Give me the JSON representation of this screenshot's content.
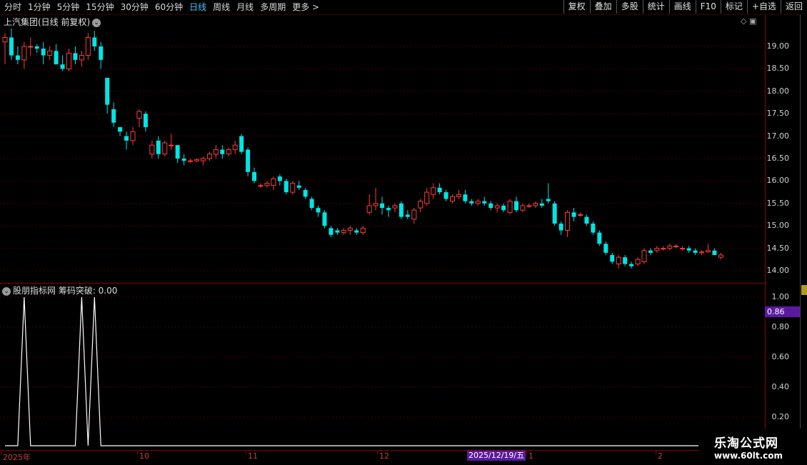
{
  "toolbar": {
    "periods": [
      "分时",
      "1分钟",
      "5分钟",
      "15分钟",
      "30分钟",
      "60分钟",
      "日线",
      "周线",
      "月线",
      "多周期",
      "更多 >"
    ],
    "active": "日线",
    "right_buttons": [
      "复权",
      "叠加",
      "多股",
      "统计",
      "画线",
      "F10",
      "标记",
      "+自选",
      "返回"
    ]
  },
  "chart": {
    "title": "上汽集团(日线 前复权)",
    "price_ticks": [
      "19.00",
      "18.50",
      "18.00",
      "17.50",
      "17.00",
      "16.50",
      "16.00",
      "15.50",
      "15.00",
      "14.50",
      "14.00"
    ],
    "indicator_title": "股朋指标网 筹码突破: 0.00",
    "indicator_ticks": [
      "1.00",
      "0.80",
      "0.60",
      "0.40",
      "0.20"
    ],
    "indicator_current": "0.86",
    "date_labels": [
      "2025年",
      "10",
      "11",
      "12",
      "1",
      "2"
    ],
    "date_highlight": "2025/12/19/五",
    "colors": {
      "up": "#ff3b3b",
      "down": "#00e5e5",
      "indicator": "#ffffff",
      "axis": "#8a0000"
    }
  },
  "watermark": {
    "title": "乐淘公式网",
    "url": "www.60lt.com"
  },
  "chart_data": {
    "type": "candlestick",
    "title": "上汽集团(日线 前复权)",
    "candles": [
      [
        19.1,
        19.3,
        18.6,
        19.2
      ],
      [
        19.2,
        19.4,
        18.7,
        18.8
      ],
      [
        18.8,
        19.0,
        18.6,
        18.7
      ],
      [
        18.7,
        19.1,
        18.5,
        19.0
      ],
      [
        19.0,
        19.2,
        18.8,
        19.0
      ],
      [
        19.0,
        19.05,
        18.85,
        18.95
      ],
      [
        18.95,
        19.1,
        18.6,
        18.8
      ],
      [
        18.8,
        19.0,
        18.7,
        18.9
      ],
      [
        18.9,
        19.05,
        18.6,
        18.6
      ],
      [
        18.6,
        18.8,
        18.45,
        18.5
      ],
      [
        18.5,
        18.95,
        18.45,
        18.85
      ],
      [
        18.85,
        19.0,
        18.6,
        18.7
      ],
      [
        18.7,
        18.9,
        18.55,
        18.8
      ],
      [
        18.8,
        19.3,
        18.7,
        19.2
      ],
      [
        19.2,
        19.35,
        18.9,
        19.0
      ],
      [
        19.0,
        19.1,
        18.5,
        18.7
      ],
      [
        18.3,
        18.3,
        17.5,
        17.7
      ],
      [
        17.6,
        17.75,
        17.2,
        17.3
      ],
      [
        17.2,
        17.2,
        17.0,
        17.1
      ],
      [
        17.0,
        17.1,
        16.7,
        16.9
      ],
      [
        16.9,
        17.2,
        16.8,
        17.1
      ],
      [
        17.4,
        17.6,
        17.2,
        17.55
      ],
      [
        17.5,
        17.55,
        17.1,
        17.2
      ],
      [
        16.6,
        16.9,
        16.5,
        16.8
      ],
      [
        16.9,
        17.0,
        16.5,
        16.6
      ],
      [
        16.6,
        16.9,
        16.55,
        16.85
      ],
      [
        16.8,
        17.05,
        16.7,
        16.8
      ],
      [
        16.8,
        16.8,
        16.4,
        16.5
      ],
      [
        16.5,
        16.6,
        16.35,
        16.45
      ],
      [
        16.45,
        16.5,
        16.4,
        16.45
      ],
      [
        16.45,
        16.5,
        16.42,
        16.48
      ],
      [
        16.45,
        16.55,
        16.35,
        16.5
      ],
      [
        16.5,
        16.65,
        16.45,
        16.6
      ],
      [
        16.6,
        16.8,
        16.5,
        16.7
      ],
      [
        16.7,
        16.8,
        16.5,
        16.6
      ],
      [
        16.6,
        16.75,
        16.55,
        16.7
      ],
      [
        16.7,
        16.9,
        16.6,
        16.8
      ],
      [
        17.0,
        17.05,
        16.6,
        16.65
      ],
      [
        16.7,
        16.75,
        16.1,
        16.2
      ],
      [
        16.2,
        16.3,
        15.95,
        16.0
      ],
      [
        15.9,
        15.95,
        15.85,
        15.9
      ],
      [
        15.9,
        16.0,
        15.85,
        15.95
      ],
      [
        15.9,
        16.1,
        15.8,
        16.05
      ],
      [
        16.1,
        16.15,
        15.9,
        16.0
      ],
      [
        16.0,
        16.05,
        15.7,
        15.75
      ],
      [
        15.75,
        16.0,
        15.7,
        15.95
      ],
      [
        15.9,
        16.0,
        15.8,
        15.85
      ],
      [
        15.8,
        15.85,
        15.6,
        15.65
      ],
      [
        15.6,
        15.65,
        15.35,
        15.4
      ],
      [
        15.4,
        15.45,
        15.2,
        15.3
      ],
      [
        15.3,
        15.35,
        14.95,
        15.0
      ],
      [
        14.95,
        15.0,
        14.75,
        14.8
      ],
      [
        14.9,
        14.95,
        14.8,
        14.85
      ],
      [
        14.85,
        14.95,
        14.8,
        14.9
      ],
      [
        14.9,
        15.0,
        14.8,
        14.95
      ],
      [
        14.9,
        14.95,
        14.8,
        14.85
      ],
      [
        14.85,
        15.0,
        14.8,
        14.95
      ],
      [
        15.3,
        15.7,
        15.25,
        15.45
      ],
      [
        15.45,
        15.85,
        15.35,
        15.5
      ],
      [
        15.5,
        15.65,
        15.25,
        15.4
      ],
      [
        15.4,
        15.45,
        15.2,
        15.35
      ],
      [
        15.4,
        15.5,
        15.3,
        15.45
      ],
      [
        15.5,
        15.55,
        15.15,
        15.2
      ],
      [
        15.25,
        15.35,
        15.15,
        15.2
      ],
      [
        15.15,
        15.4,
        15.05,
        15.35
      ],
      [
        15.4,
        15.6,
        15.3,
        15.55
      ],
      [
        15.5,
        15.85,
        15.45,
        15.75
      ],
      [
        15.7,
        15.95,
        15.6,
        15.85
      ],
      [
        15.85,
        15.95,
        15.7,
        15.75
      ],
      [
        15.75,
        15.8,
        15.55,
        15.6
      ],
      [
        15.55,
        15.7,
        15.5,
        15.65
      ],
      [
        15.65,
        15.8,
        15.6,
        15.7
      ],
      [
        15.7,
        15.8,
        15.5,
        15.55
      ],
      [
        15.55,
        15.6,
        15.45,
        15.5
      ],
      [
        15.5,
        15.6,
        15.45,
        15.55
      ],
      [
        15.55,
        15.65,
        15.45,
        15.5
      ],
      [
        15.5,
        15.55,
        15.35,
        15.4
      ],
      [
        15.4,
        15.5,
        15.3,
        15.45
      ],
      [
        15.45,
        15.5,
        15.3,
        15.35
      ],
      [
        15.3,
        15.6,
        15.25,
        15.55
      ],
      [
        15.55,
        15.65,
        15.3,
        15.35
      ],
      [
        15.35,
        15.5,
        15.3,
        15.45
      ],
      [
        15.45,
        15.5,
        15.4,
        15.45
      ],
      [
        15.45,
        15.55,
        15.4,
        15.5
      ],
      [
        15.5,
        15.6,
        15.4,
        15.45
      ],
      [
        15.6,
        15.95,
        15.5,
        15.55
      ],
      [
        15.5,
        15.55,
        15.0,
        15.05
      ],
      [
        15.05,
        15.1,
        14.8,
        14.9
      ],
      [
        14.9,
        15.35,
        14.75,
        15.3
      ],
      [
        15.3,
        15.4,
        15.1,
        15.2
      ],
      [
        15.25,
        15.3,
        15.2,
        15.25
      ],
      [
        15.2,
        15.25,
        15.0,
        15.05
      ],
      [
        15.05,
        15.1,
        14.8,
        14.85
      ],
      [
        14.85,
        14.9,
        14.55,
        14.6
      ],
      [
        14.6,
        14.65,
        14.35,
        14.4
      ],
      [
        14.35,
        14.4,
        14.15,
        14.2
      ],
      [
        14.15,
        14.35,
        14.05,
        14.3
      ],
      [
        14.3,
        14.35,
        14.1,
        14.15
      ],
      [
        14.15,
        14.2,
        14.05,
        14.1
      ],
      [
        14.15,
        14.3,
        14.1,
        14.25
      ],
      [
        14.2,
        14.5,
        14.15,
        14.45
      ],
      [
        14.45,
        14.5,
        14.35,
        14.4
      ],
      [
        14.45,
        14.55,
        14.4,
        14.5
      ],
      [
        14.5,
        14.55,
        14.45,
        14.5
      ],
      [
        14.5,
        14.6,
        14.45,
        14.55
      ],
      [
        14.55,
        14.6,
        14.5,
        14.55
      ],
      [
        14.5,
        14.55,
        14.45,
        14.5
      ],
      [
        14.5,
        14.55,
        14.4,
        14.45
      ],
      [
        14.45,
        14.5,
        14.35,
        14.4
      ],
      [
        14.4,
        14.45,
        14.35,
        14.42
      ],
      [
        14.42,
        14.6,
        14.4,
        14.45
      ],
      [
        14.45,
        14.5,
        14.35,
        14.35
      ],
      [
        14.3,
        14.4,
        14.25,
        14.35
      ]
    ],
    "indicator": {
      "name": "筹码突破",
      "values": [
        0,
        0,
        0,
        1,
        0,
        0,
        0,
        0,
        0,
        0,
        0,
        0,
        1,
        0,
        1,
        0,
        0,
        0,
        0,
        0,
        0,
        0,
        0,
        0,
        0,
        0,
        0,
        0,
        0,
        0,
        0,
        0,
        0,
        0,
        0,
        0,
        0,
        0,
        0,
        0,
        0,
        0,
        0,
        0,
        0,
        0,
        0,
        0,
        0,
        0,
        0,
        0,
        0,
        0,
        0,
        0,
        0,
        0,
        0,
        0,
        0,
        0,
        0,
        0,
        0,
        0,
        0,
        0,
        0,
        0,
        0,
        0,
        0,
        0,
        0,
        0,
        0,
        0,
        0,
        0,
        0,
        0,
        0,
        0,
        0,
        0,
        0,
        0,
        0,
        0,
        0,
        0,
        0,
        0,
        0,
        0,
        0,
        0,
        0,
        0,
        0,
        0,
        0,
        0,
        0,
        0,
        0,
        0,
        0,
        0,
        0,
        0,
        0,
        0,
        0,
        0,
        0,
        0,
        0,
        0,
        0,
        0,
        0,
        0,
        0,
        0,
        0,
        0,
        0,
        0,
        0,
        0,
        0,
        0,
        0,
        0,
        0,
        0,
        0
      ]
    },
    "price_ylim": [
      13.9,
      19.6
    ],
    "indicator_ylim": [
      0,
      1.05
    ],
    "grid": true
  }
}
